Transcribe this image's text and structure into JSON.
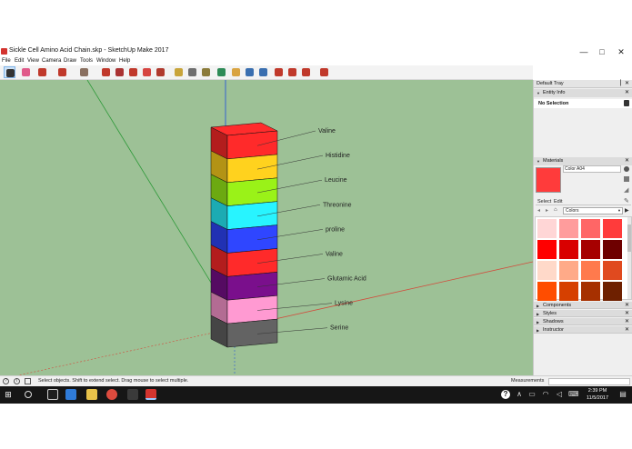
{
  "window": {
    "title": "Sickle Cell Amino Acid Chain.skp - SketchUp Make 2017",
    "minimize_glyph": "—",
    "maximize_glyph": "□",
    "close_glyph": "✕"
  },
  "menu": [
    "File",
    "Edit",
    "View",
    "Camera",
    "Draw",
    "Tools",
    "Window",
    "Help"
  ],
  "toolbar": {
    "tools": [
      {
        "icon": "select-arrow-icon",
        "color": "#333333",
        "selected": true
      },
      {
        "icon": "eraser-icon",
        "color": "#e05a8a"
      },
      {
        "icon": "pencil-icon",
        "color": "#c0392b"
      },
      {
        "icon": "lasso-icon",
        "color": "#c0392b"
      },
      {
        "icon": "paint-bucket-icon",
        "color": "#8a7060"
      },
      {
        "icon": "move-icon",
        "color": "#c0392b"
      },
      {
        "icon": "push-pull-icon",
        "color": "#a33"
      },
      {
        "icon": "move-cross-icon",
        "color": "#c0392b"
      },
      {
        "icon": "rotate-icon",
        "color": "#d64541"
      },
      {
        "icon": "scale-icon",
        "color": "#b03a2e"
      },
      {
        "icon": "tape-measure-icon",
        "color": "#c8a43a"
      },
      {
        "icon": "text-icon",
        "color": "#6e6e6e"
      },
      {
        "icon": "axes-icon",
        "color": "#8b7b3a"
      },
      {
        "icon": "orbit-icon",
        "color": "#2e8b57"
      },
      {
        "icon": "pan-icon",
        "color": "#d9a441"
      },
      {
        "icon": "zoom-icon",
        "color": "#3a6fb0"
      },
      {
        "icon": "zoom-extents-icon",
        "color": "#3a6fb0"
      },
      {
        "icon": "warehouse-icon",
        "color": "#c0392b"
      },
      {
        "icon": "extension-icon",
        "color": "#c0392b"
      },
      {
        "icon": "share-icon",
        "color": "#c0392b"
      },
      {
        "icon": "layout-icon",
        "color": "#c0392b"
      }
    ]
  },
  "model": {
    "segments": [
      {
        "name": "Valine",
        "color": "#ff2a2a"
      },
      {
        "name": "Histidine",
        "color": "#ffd21e"
      },
      {
        "name": "Leucine",
        "color": "#9af218"
      },
      {
        "name": "Threonine",
        "color": "#28f4ff"
      },
      {
        "name": "proline",
        "color": "#2f46ff"
      },
      {
        "name": "Valine",
        "color": "#ff2a2a"
      },
      {
        "name": "Glutamic Acid",
        "color": "#7a0f8c"
      },
      {
        "name": "Lysine",
        "color": "#ff9ad2"
      },
      {
        "name": "Serine",
        "color": "#636363"
      }
    ]
  },
  "tray": {
    "title": "Default Tray",
    "entity_info": {
      "header": "Entity Info",
      "value": "No Selection"
    },
    "materials": {
      "header": "Materials",
      "current_name": "Color A04",
      "current_color": "#ff3b3b",
      "tab_select": "Select",
      "tab_edit": "Edit",
      "library": "Colors",
      "swatches": [
        "#ffd6d6",
        "#ff9c9c",
        "#ff6666",
        "#ff3b3b",
        "#ff0000",
        "#d90000",
        "#a60000",
        "#6e0000",
        "#ffd9c9",
        "#ffaa88",
        "#ff7a4d",
        "#e04a1f",
        "#ff4d00",
        "#d64000",
        "#a63000",
        "#6e2000"
      ]
    },
    "collapsed_panels": [
      "Components",
      "Styles",
      "Shadows",
      "Instructor"
    ]
  },
  "status": {
    "message": "Select objects. Shift to extend select. Drag mouse to select multiple.",
    "measurements_label": "Measurements"
  },
  "taskbar": {
    "apps": [
      {
        "icon": "task-view-icon",
        "color": "#1e1e1e"
      },
      {
        "icon": "edge-icon",
        "color": "#2f7bd8"
      },
      {
        "icon": "file-explorer-icon",
        "color": "#e8c24a"
      },
      {
        "icon": "chrome-icon",
        "color": "#dd4b3e"
      },
      {
        "icon": "mail-icon",
        "color": "#3a3a3a"
      },
      {
        "icon": "sketchup-icon",
        "color": "#d3342f"
      }
    ],
    "time": "2:39 PM",
    "date": "11/5/2017"
  }
}
